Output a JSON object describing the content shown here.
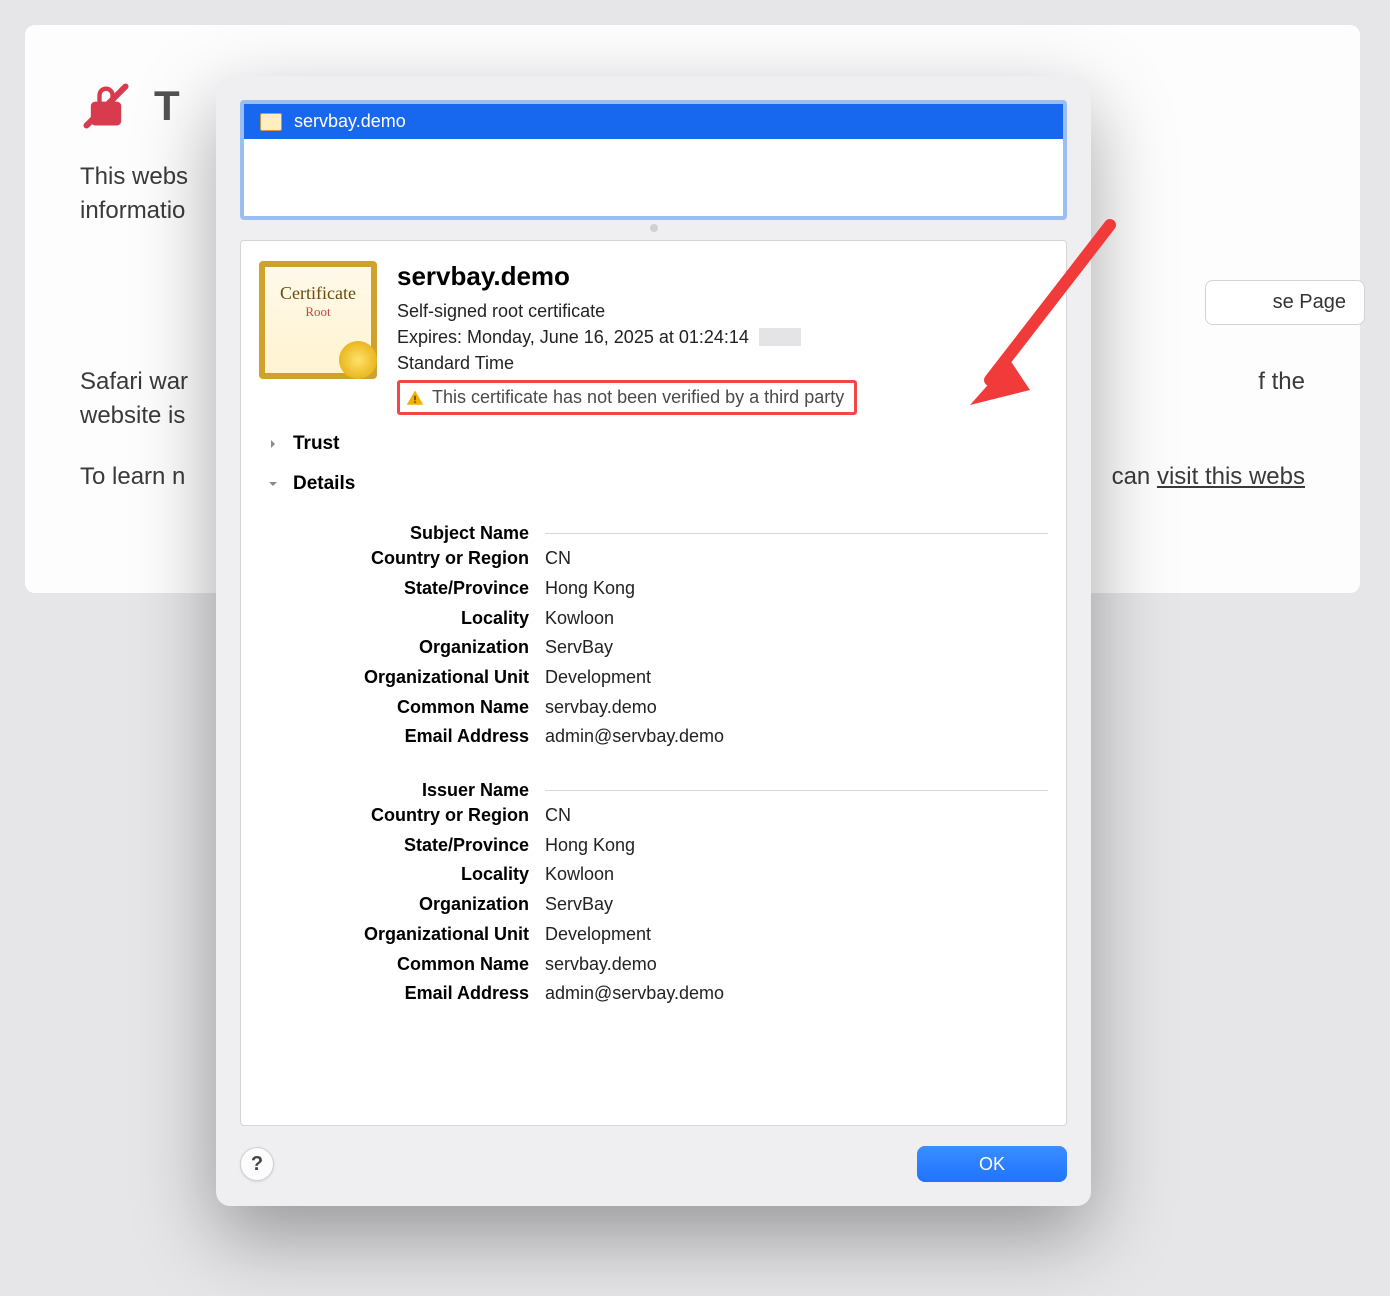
{
  "page": {
    "title_fragment": "T",
    "body_line1": "This webs",
    "body_line2": "informatio",
    "warn_line1": "Safari war",
    "warn_line1_tail": "f the",
    "warn_line2": "website is",
    "learn_prefix": "To learn n",
    "learn_mid": "can ",
    "learn_link": "visit this webs",
    "close_button": "se Page"
  },
  "dialog": {
    "tree_item": "servbay.demo",
    "cert": {
      "icon_text_top": "Certificate",
      "icon_text_bottom": "Root",
      "title": "servbay.demo",
      "subtitle": "Self-signed root certificate",
      "expires_label": "Expires: ",
      "expires_value": "Monday, June 16, 2025 at 01:24:14",
      "expires_tz": "Standard Time",
      "warn": "This certificate has not been verified by a third party"
    },
    "sections": {
      "trust": "Trust",
      "details": "Details"
    },
    "subject": {
      "heading": "Subject Name",
      "fields": [
        {
          "label": "Country or Region",
          "value": "CN"
        },
        {
          "label": "State/Province",
          "value": "Hong Kong"
        },
        {
          "label": "Locality",
          "value": "Kowloon"
        },
        {
          "label": "Organization",
          "value": "ServBay"
        },
        {
          "label": "Organizational Unit",
          "value": "Development"
        },
        {
          "label": "Common Name",
          "value": "servbay.demo"
        },
        {
          "label": "Email Address",
          "value": "admin@servbay.demo"
        }
      ]
    },
    "issuer": {
      "heading": "Issuer Name",
      "fields": [
        {
          "label": "Country or Region",
          "value": "CN"
        },
        {
          "label": "State/Province",
          "value": "Hong Kong"
        },
        {
          "label": "Locality",
          "value": "Kowloon"
        },
        {
          "label": "Organization",
          "value": "ServBay"
        },
        {
          "label": "Organizational Unit",
          "value": "Development"
        },
        {
          "label": "Common Name",
          "value": "servbay.demo"
        },
        {
          "label": "Email Address",
          "value": "admin@servbay.demo"
        }
      ]
    },
    "help": "?",
    "ok": "OK"
  }
}
